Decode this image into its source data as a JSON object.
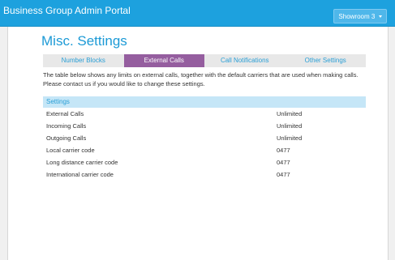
{
  "app": {
    "title": "Business Group Admin Portal",
    "group_selector": "Showroom 3"
  },
  "page": {
    "title": "Misc. Settings",
    "tabs": [
      {
        "label": "Number Blocks",
        "active": false
      },
      {
        "label": "External Calls",
        "active": true
      },
      {
        "label": "Call Notifications",
        "active": false
      },
      {
        "label": "Other Settings",
        "active": false
      }
    ],
    "description": "The table below shows any limits on external calls, together with the default carriers that are used when making calls. Please contact us if you would like to change these settings."
  },
  "settings": {
    "header": "Settings",
    "rows": [
      {
        "label": "External Calls",
        "value": "Unlimited"
      },
      {
        "label": "Incoming Calls",
        "value": "Unlimited"
      },
      {
        "label": "Outgoing Calls",
        "value": "Unlimited"
      },
      {
        "label": "Local carrier code",
        "value": "0477"
      },
      {
        "label": "Long distance carrier code",
        "value": "0477"
      },
      {
        "label": "International carrier code",
        "value": "0477"
      }
    ]
  },
  "colors": {
    "topbar": "#1da1de",
    "accent": "#1c9ad6",
    "active_tab": "#955e9f",
    "settings_header": "#c5e6f7"
  },
  "icons": {
    "group_dropdown": "chevron-down-icon"
  }
}
